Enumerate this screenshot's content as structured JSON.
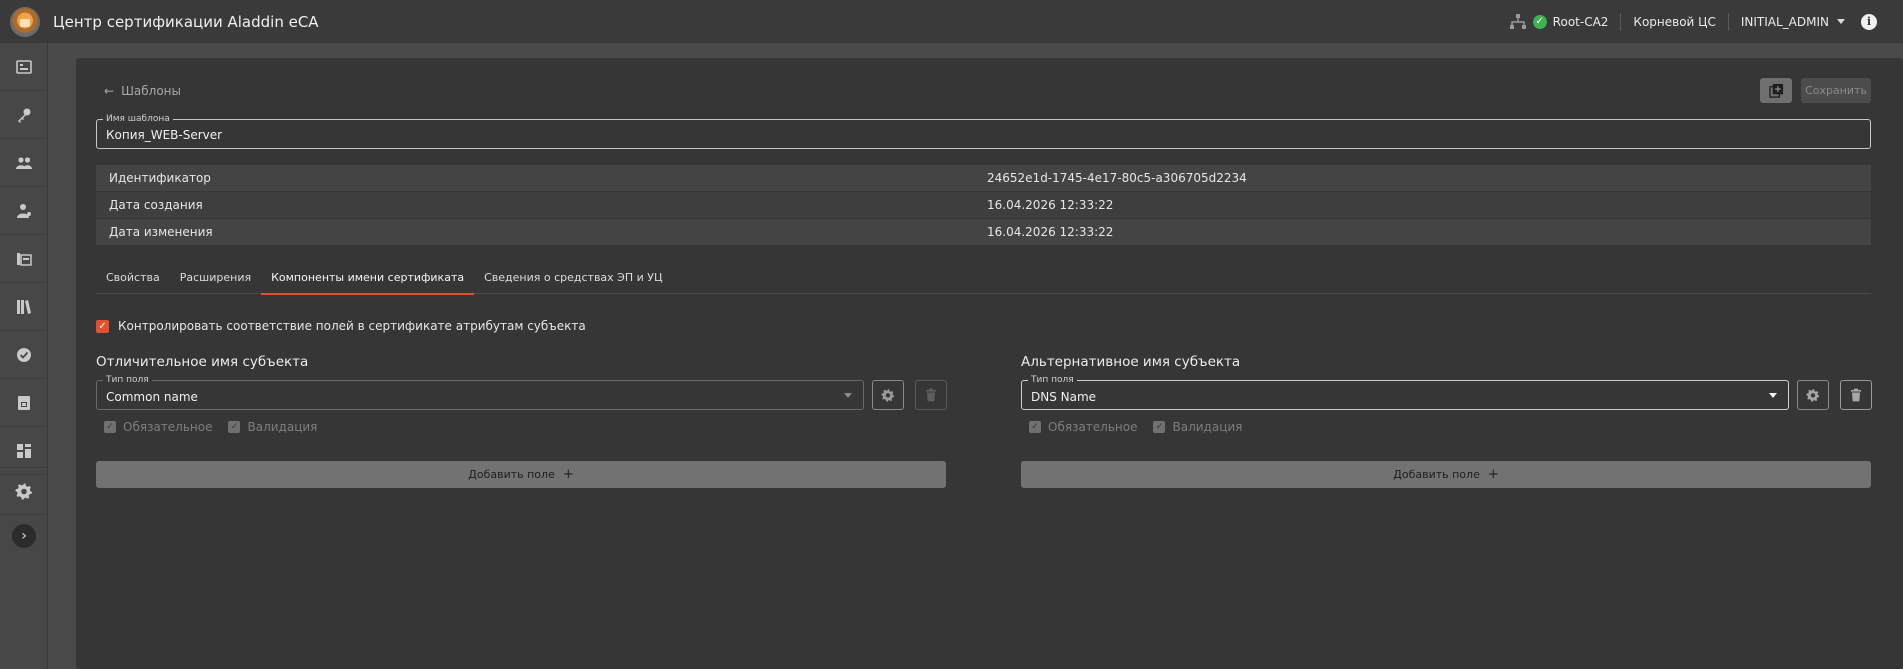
{
  "header": {
    "app_title": "Центр сертификации Aladdin eCA",
    "ca_name": "Root-CA2",
    "ca_type": "Корневой ЦС",
    "user": "INITIAL_ADMIN"
  },
  "sidebar": {
    "items": [
      {
        "icon": "dashboard-icon"
      },
      {
        "icon": "key-icon"
      },
      {
        "icon": "users-icon"
      },
      {
        "icon": "user-admin-icon"
      },
      {
        "icon": "certificate-folder-icon"
      },
      {
        "icon": "library-icon"
      },
      {
        "icon": "check-circle-icon"
      },
      {
        "icon": "document-lock-icon"
      },
      {
        "icon": "templates-icon"
      }
    ],
    "settings_icon": "gear-icon",
    "expand_icon": "chevron-right-icon"
  },
  "page": {
    "back_label": "Шаблоны",
    "save_label": "Сохранить",
    "template_name_label": "Имя шаблона",
    "template_name_value": "Копия_WEB-Server",
    "info": [
      {
        "key": "Идентификатор",
        "value": "24652e1d-1745-4e17-80c5-a306705d2234"
      },
      {
        "key": "Дата создания",
        "value": "16.04.2026 12:33:22"
      },
      {
        "key": "Дата изменения",
        "value": "16.04.2026 12:33:22"
      }
    ],
    "tabs": [
      {
        "label": "Свойства",
        "active": false
      },
      {
        "label": "Расширения",
        "active": false
      },
      {
        "label": "Компоненты имени сертификата",
        "active": true
      },
      {
        "label": "Сведения о средствах ЭП и УЦ",
        "active": false
      }
    ],
    "control_checkbox_label": "Контролировать соответствие полей в сертификате атрибутам субъекта",
    "subject_dn": {
      "title": "Отличительное имя субъекта",
      "field_type_label": "Тип поля",
      "field_type_value": "Common name",
      "required_label": "Обязательное",
      "validation_label": "Валидация",
      "add_label": "Добавить поле"
    },
    "subject_alt": {
      "title": "Альтернативное имя субъекта",
      "field_type_label": "Тип поля",
      "field_type_value": "DNS Name",
      "required_label": "Обязательное",
      "validation_label": "Валидация",
      "add_label": "Добавить поле"
    }
  },
  "colors": {
    "accent": "#e0522d",
    "status_ok": "#3fb34f"
  }
}
